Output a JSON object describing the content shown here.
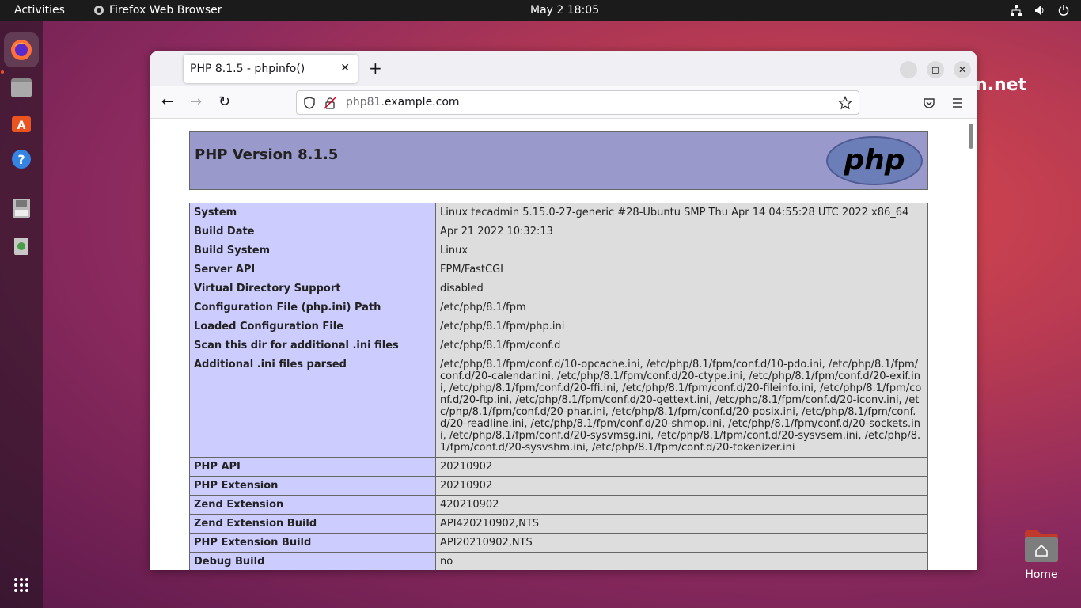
{
  "topbar": {
    "activities": "Activities",
    "app_name": "Firefox Web Browser",
    "clock": "May 2  18:05"
  },
  "desktop": {
    "bg_text": "n.net",
    "home_label": "Home"
  },
  "browser": {
    "tab_title": "PHP 8.1.5 - phpinfo()",
    "url_host_prefix": "php81.",
    "url_host_domain": "example.com"
  },
  "phpinfo": {
    "heading": "PHP Version 8.1.5",
    "logo_text": "php",
    "rows": [
      {
        "key": "System",
        "value": "Linux tecadmin 5.15.0-27-generic #28-Ubuntu SMP Thu Apr 14 04:55:28 UTC 2022 x86_64"
      },
      {
        "key": "Build Date",
        "value": "Apr 21 2022 10:32:13"
      },
      {
        "key": "Build System",
        "value": "Linux"
      },
      {
        "key": "Server API",
        "value": "FPM/FastCGI"
      },
      {
        "key": "Virtual Directory Support",
        "value": "disabled"
      },
      {
        "key": "Configuration File (php.ini) Path",
        "value": "/etc/php/8.1/fpm"
      },
      {
        "key": "Loaded Configuration File",
        "value": "/etc/php/8.1/fpm/php.ini"
      },
      {
        "key": "Scan this dir for additional .ini files",
        "value": "/etc/php/8.1/fpm/conf.d"
      },
      {
        "key": "Additional .ini files parsed",
        "value": "/etc/php/8.1/fpm/conf.d/10-opcache.ini, /etc/php/8.1/fpm/conf.d/10-pdo.ini, /etc/php/8.1/fpm/conf.d/20-calendar.ini, /etc/php/8.1/fpm/conf.d/20-ctype.ini, /etc/php/8.1/fpm/conf.d/20-exif.ini, /etc/php/8.1/fpm/conf.d/20-ffi.ini, /etc/php/8.1/fpm/conf.d/20-fileinfo.ini, /etc/php/8.1/fpm/conf.d/20-ftp.ini, /etc/php/8.1/fpm/conf.d/20-gettext.ini, /etc/php/8.1/fpm/conf.d/20-iconv.ini, /etc/php/8.1/fpm/conf.d/20-phar.ini, /etc/php/8.1/fpm/conf.d/20-posix.ini, /etc/php/8.1/fpm/conf.d/20-readline.ini, /etc/php/8.1/fpm/conf.d/20-shmop.ini, /etc/php/8.1/fpm/conf.d/20-sockets.ini, /etc/php/8.1/fpm/conf.d/20-sysvmsg.ini, /etc/php/8.1/fpm/conf.d/20-sysvsem.ini, /etc/php/8.1/fpm/conf.d/20-sysvshm.ini, /etc/php/8.1/fpm/conf.d/20-tokenizer.ini"
      },
      {
        "key": "PHP API",
        "value": "20210902"
      },
      {
        "key": "PHP Extension",
        "value": "20210902"
      },
      {
        "key": "Zend Extension",
        "value": "420210902"
      },
      {
        "key": "Zend Extension Build",
        "value": "API420210902,NTS"
      },
      {
        "key": "PHP Extension Build",
        "value": "API20210902,NTS"
      },
      {
        "key": "Debug Build",
        "value": "no"
      }
    ]
  }
}
